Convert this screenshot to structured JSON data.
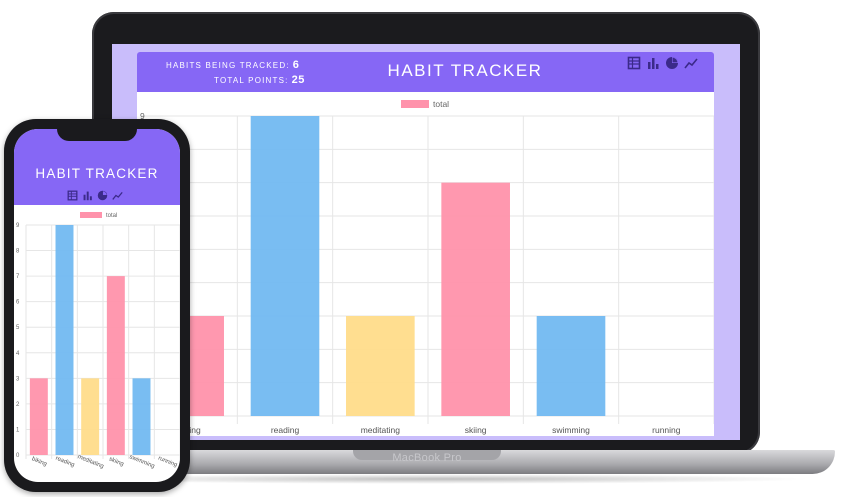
{
  "laptop": {
    "brand": "MacBook Pro",
    "app": {
      "title": "HABIT TRACKER",
      "stats": [
        {
          "label": "HABITS BEING TRACKED:",
          "value": "6"
        },
        {
          "label": "TOTAL POINTS:",
          "value": "25"
        }
      ],
      "icons": [
        "table-icon",
        "bar-chart-icon",
        "pie-chart-icon",
        "line-chart-icon"
      ]
    }
  },
  "phone": {
    "app": {
      "title": "HABIT TRACKER",
      "icons": [
        "table-icon",
        "bar-chart-icon",
        "pie-chart-icon",
        "line-chart-icon"
      ]
    }
  },
  "colors": {
    "accent": "#8667f5",
    "pink": "#ff92ab",
    "blue": "#72b9f1",
    "yellow": "#ffdc8a",
    "background": "#c9bdfb"
  },
  "chart_data": [
    {
      "type": "bar",
      "device": "laptop",
      "categories": [
        "biking",
        "reading",
        "meditating",
        "skiing",
        "swimming",
        "running"
      ],
      "series": [
        {
          "name": "total",
          "values": [
            3,
            9,
            3,
            7,
            3,
            0
          ]
        }
      ],
      "bar_colors": [
        "#ff92ab",
        "#72b9f1",
        "#ffdc8a",
        "#ff92ab",
        "#72b9f1",
        "#ffdc8a"
      ],
      "ylim": [
        0,
        9
      ],
      "y_ticks": [
        "9"
      ],
      "grid": true,
      "legend": "top-center"
    },
    {
      "type": "bar",
      "device": "phone",
      "categories": [
        "biking",
        "reading",
        "meditating",
        "skiing",
        "swimming",
        "running"
      ],
      "series": [
        {
          "name": "total",
          "values": [
            3,
            9,
            3,
            7,
            3,
            0
          ]
        }
      ],
      "bar_colors": [
        "#ff92ab",
        "#72b9f1",
        "#ffdc8a",
        "#ff92ab",
        "#72b9f1",
        "#ffdc8a"
      ],
      "ylim": [
        0,
        9
      ],
      "y_ticks": [
        "0",
        "1",
        "2",
        "3",
        "4",
        "5",
        "6",
        "7",
        "8",
        "9"
      ],
      "grid": true,
      "legend": "top-center"
    }
  ]
}
